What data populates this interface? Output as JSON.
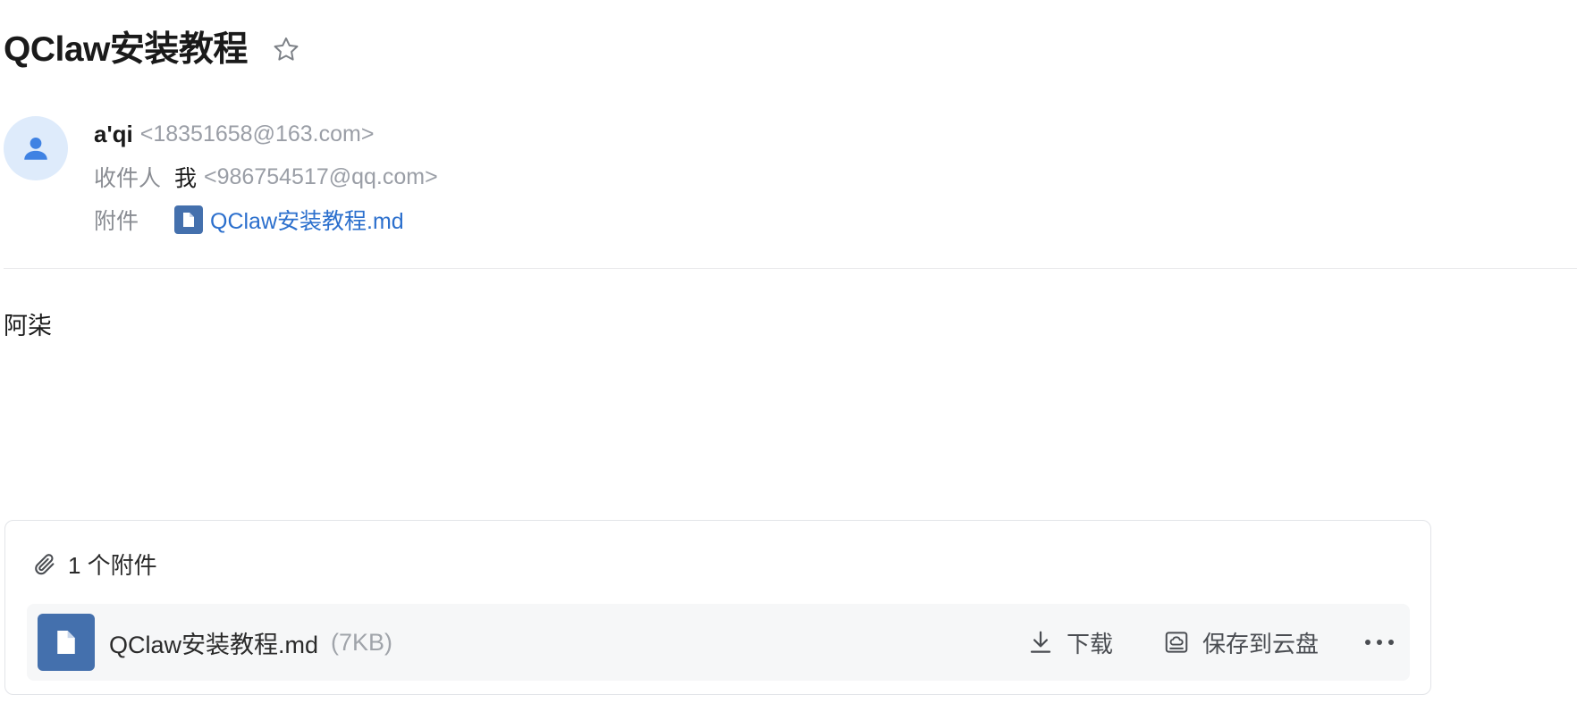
{
  "email": {
    "subject": "QClaw安装教程",
    "sender": {
      "name": "a'qi",
      "address": "<18351658@163.com>"
    },
    "recipient": {
      "label": "收件人",
      "name": "我",
      "address": "<986754517@qq.com>"
    },
    "attachment_line": {
      "label": "附件",
      "filename": "QClaw安装教程.md"
    },
    "body": "阿柒"
  },
  "attachments_panel": {
    "count_label": "1 个附件",
    "files": [
      {
        "name": "QClaw安装教程.md",
        "size": "(7KB)",
        "icon": "document-icon"
      }
    ],
    "actions": {
      "download": "下载",
      "save_to_cloud": "保存到云盘"
    }
  },
  "colors": {
    "link": "#2b6fcd",
    "file_icon_bg": "#4470ad",
    "avatar_bg": "#deebfb",
    "avatar_fg": "#3f82e3"
  }
}
